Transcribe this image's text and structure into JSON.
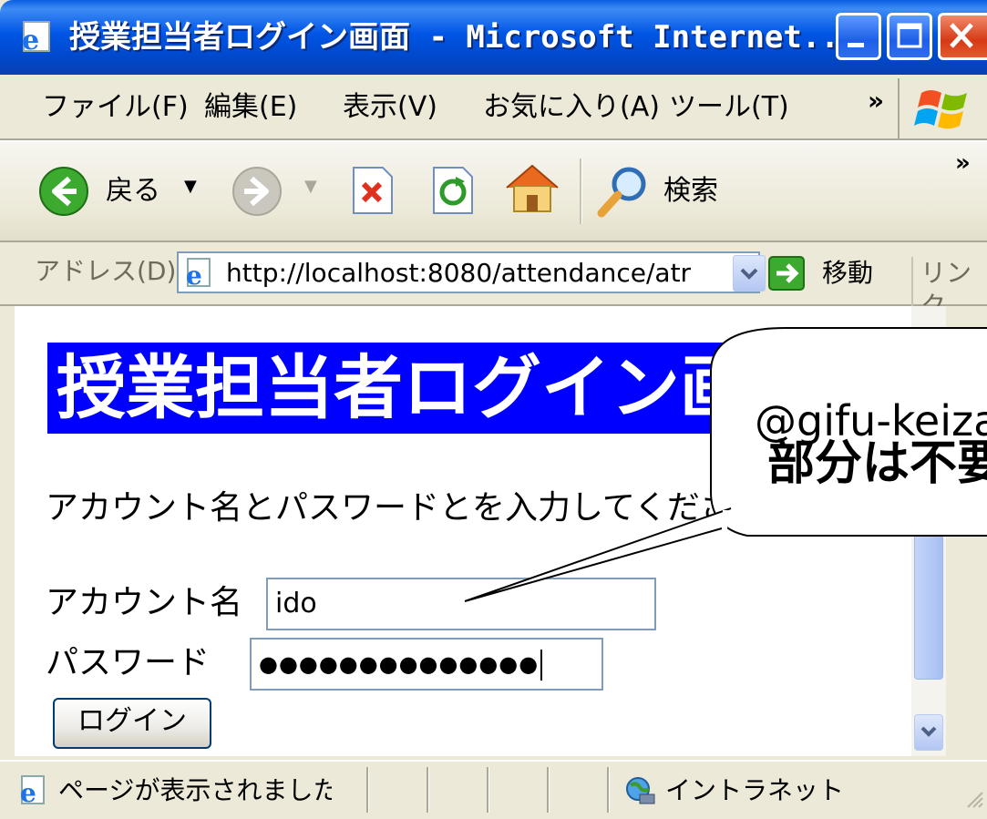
{
  "window": {
    "title": "授業担当者ログイン画面 - Microsoft Internet...",
    "buttons": [
      "minimize",
      "maximize",
      "close"
    ]
  },
  "menubar": {
    "items": [
      "ファイル(F)",
      "編集(E)",
      "表示(V)",
      "お気に入り(A)",
      "ツール(T)"
    ],
    "more": "»"
  },
  "toolbar": {
    "back_label": "戻る",
    "search_label": "検索",
    "more": "»"
  },
  "address": {
    "label": "アドレス(D)",
    "url": "http://localhost:8080/attendance/atr",
    "go_label": "移動",
    "links_label": "リンク"
  },
  "page": {
    "heading": "授業担当者ログイン画面",
    "instruction": "アカウント名とパスワードとを入力してください。",
    "account_label": "アカウント名",
    "account_value": "ido",
    "password_label": "パスワード",
    "password_value": "●●●●●●●●●●●●●●",
    "login_label": "ログイン"
  },
  "status": {
    "text": "ページが表示されました",
    "zone": "イントラネット"
  },
  "callout": {
    "line1": "@gifu-keizai.ac.jp",
    "line2": "部分は不要"
  },
  "colors": {
    "title_bar": "#0055E5",
    "heading_bg": "#0000FF",
    "chrome": "#ECE9D8"
  }
}
